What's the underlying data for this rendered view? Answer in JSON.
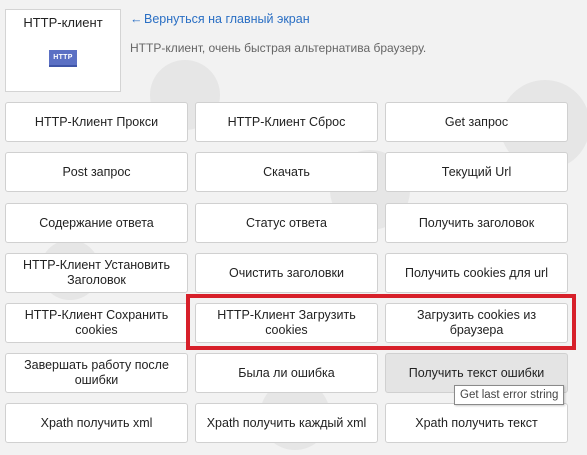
{
  "header": {
    "tile_title": "HTTP-клиент",
    "icon_label": "HTTP",
    "back_link": "Вернуться на главный экран",
    "back_arrow": "←",
    "description": "HTTP-клиент, очень быстрая альтернатива браузеру."
  },
  "buttons": [
    [
      "HTTP-Клиент Прокси",
      "HTTP-Клиент Сброс",
      "Get запрос"
    ],
    [
      "Post запрос",
      "Скачать",
      "Текущий Url"
    ],
    [
      "Содержание ответа",
      "Статус ответа",
      "Получить заголовок"
    ],
    [
      "HTTP-Клиент Установить Заголовок",
      "Очистить заголовки",
      "Получить cookies для url"
    ],
    [
      "HTTP-Клиент Сохранить cookies",
      "HTTP-Клиент Загрузить cookies",
      "Загрузить cookies из браузера"
    ],
    [
      "Завершать работу после ошибки",
      "Была ли ошибка",
      "Получить текст ошибки"
    ],
    [
      "Xpath получить xml",
      "Xpath получить каждый xml",
      "Xpath получить текст"
    ]
  ],
  "tooltip": "Get last error string",
  "colors": {
    "highlight": "#d7202a",
    "link": "#2a6fc4",
    "icon": "#5b70c4"
  }
}
